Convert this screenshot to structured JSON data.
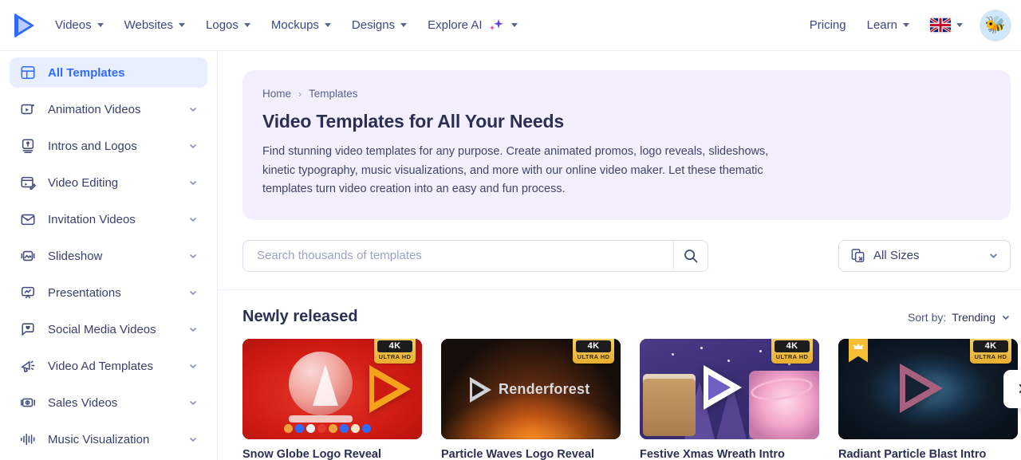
{
  "header": {
    "logo_name": "renderforest-logo",
    "nav": [
      {
        "label": "Videos",
        "has_dropdown": true
      },
      {
        "label": "Websites",
        "has_dropdown": true
      },
      {
        "label": "Logos",
        "has_dropdown": true
      },
      {
        "label": "Mockups",
        "has_dropdown": true
      },
      {
        "label": "Designs",
        "has_dropdown": true
      },
      {
        "label": "Explore AI",
        "has_dropdown": true,
        "icon": "sparkles-icon"
      }
    ],
    "pricing_label": "Pricing",
    "learn_label": "Learn",
    "language": "English (UK)",
    "avatar_icon": "bee-avatar"
  },
  "sidebar": {
    "items": [
      {
        "label": "All Templates",
        "icon": "grid-icon",
        "active": true,
        "expandable": false
      },
      {
        "label": "Animation Videos",
        "icon": "animation-icon",
        "active": false,
        "expandable": true
      },
      {
        "label": "Intros and Logos",
        "icon": "intro-icon",
        "active": false,
        "expandable": true
      },
      {
        "label": "Video Editing",
        "icon": "video-edit-icon",
        "active": false,
        "expandable": true
      },
      {
        "label": "Invitation Videos",
        "icon": "invitation-icon",
        "active": false,
        "expandable": true
      },
      {
        "label": "Slideshow",
        "icon": "slideshow-icon",
        "active": false,
        "expandable": true
      },
      {
        "label": "Presentations",
        "icon": "presentation-icon",
        "active": false,
        "expandable": true
      },
      {
        "label": "Social Media Videos",
        "icon": "social-icon",
        "active": false,
        "expandable": true
      },
      {
        "label": "Video Ad Templates",
        "icon": "megaphone-icon",
        "active": false,
        "expandable": true
      },
      {
        "label": "Sales Videos",
        "icon": "money-icon",
        "active": false,
        "expandable": true
      },
      {
        "label": "Music Visualization",
        "icon": "waveform-icon",
        "active": false,
        "expandable": true
      }
    ]
  },
  "hero": {
    "breadcrumb": {
      "home": "Home",
      "separator": "›",
      "current": "Templates"
    },
    "title": "Video Templates for All Your Needs",
    "description": "Find stunning video templates for any purpose. Create animated promos, logo reveals, slideshows, kinetic typography, music visualizations, and more with our online video maker. Let these thematic templates turn video creation into an easy and fun process.",
    "background_color": "#f4efff"
  },
  "search": {
    "placeholder": "Search thousands of templates",
    "value": "",
    "button_icon": "search-icon"
  },
  "sizes_filter": {
    "label": "All Sizes",
    "icon": "aspect-ratio-icon",
    "chevron": "chevron-down-icon"
  },
  "section": {
    "title": "Newly released",
    "sort_label": "Sort by:",
    "sort_value": "Trending"
  },
  "badges": {
    "quality_main": "4K",
    "quality_sub": "ULTRA HD",
    "premium_icon": "crown-icon"
  },
  "cards": [
    {
      "title": "Snow Globe Logo Reveal",
      "quality_badge": true,
      "premium": false,
      "thumb_alt": "snow-globe-on-red-background"
    },
    {
      "title": "Particle Waves Logo Reveal",
      "quality_badge": true,
      "premium": false,
      "thumb_alt": "orange-particle-waves-dark",
      "overlay_text": "Renderforest"
    },
    {
      "title": "Festive Xmas Wreath Intro",
      "quality_badge": true,
      "premium": false,
      "thumb_alt": "purple-christmas-scene"
    },
    {
      "title": "Radiant Particle Blast Intro",
      "quality_badge": true,
      "premium": true,
      "thumb_alt": "dark-blue-particle-blast"
    }
  ],
  "carousel": {
    "next_icon": "chevron-right-icon"
  },
  "colors": {
    "accent": "#2f6bff",
    "text": "#2b2f54",
    "hero_bg": "#f4efff",
    "badge_gold": "#e7ae2e"
  }
}
